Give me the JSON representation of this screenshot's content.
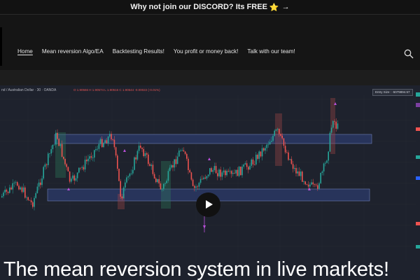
{
  "announcement": {
    "text": "Why not join our DISCORD? Its FREE",
    "star": "⭐",
    "arrow": "→"
  },
  "nav": {
    "items": [
      {
        "label": "Home",
        "active": true
      },
      {
        "label": "Mean reversion Algo/EA",
        "active": false
      },
      {
        "label": "Backtesting Results!",
        "active": false
      },
      {
        "label": "You profit or money back!",
        "active": false
      },
      {
        "label": "Talk with our team!",
        "active": false
      }
    ],
    "search_icon": "search-icon"
  },
  "video": {
    "chart_title": "nd / Australian Dollar · 30 · OANDA",
    "chart_ohlc": "O 1.90566  H 1.90574  L 1.90516  C 1.90544  -0.00022 (-0.01%)",
    "entry_box": "Entry Size : -5079894.57",
    "caption": "The mean reversion system in live markets!",
    "play_icon": "play-icon",
    "colors": {
      "up": "#26a69a",
      "down": "#ef5350",
      "zone_fill": "#2b3a66",
      "zone_border": "#6f7fb8"
    }
  }
}
